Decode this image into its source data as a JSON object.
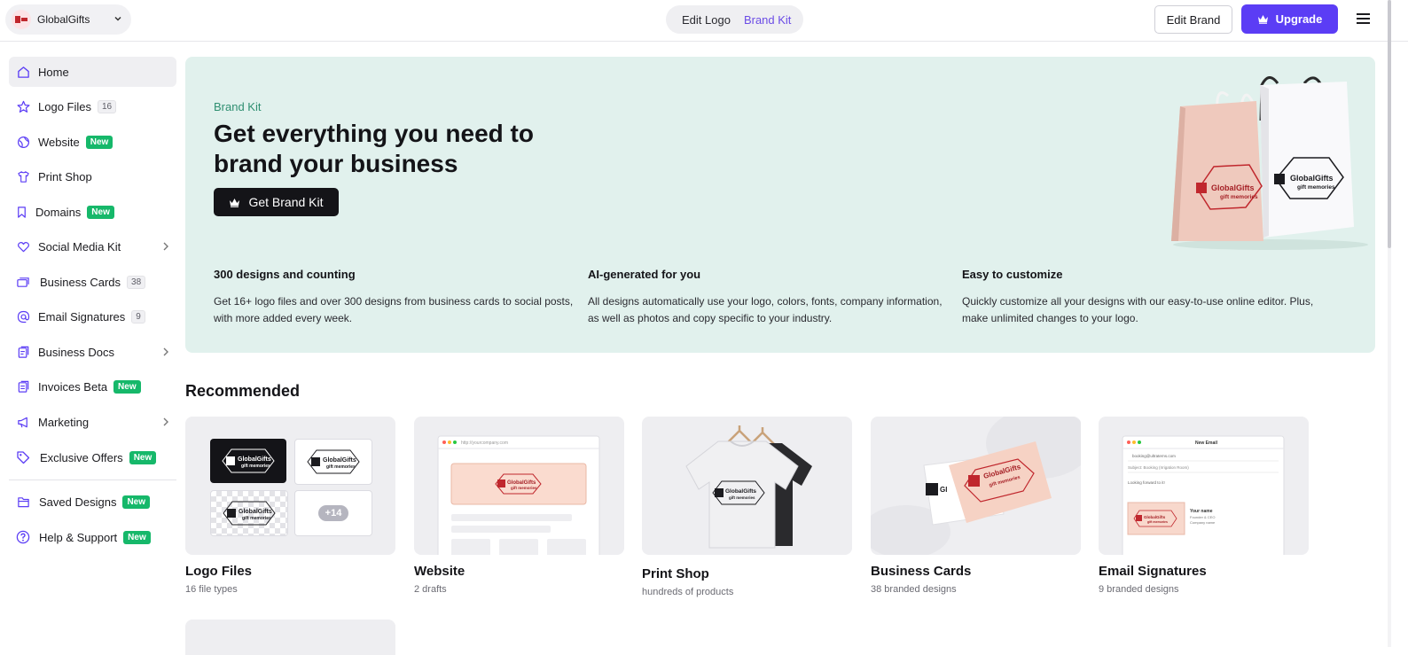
{
  "header": {
    "brand_name": "GlobalGifts",
    "mode_tabs": [
      {
        "label": "Edit Logo",
        "active": false
      },
      {
        "label": "Brand Kit",
        "active": true
      }
    ],
    "edit_brand_label": "Edit Brand",
    "upgrade_label": "Upgrade",
    "accent_color": "#5b3df5"
  },
  "sidebar": {
    "items": [
      {
        "label": "Home",
        "icon": "home-icon",
        "active": true
      },
      {
        "label": "Logo Files",
        "icon": "star-icon",
        "count": "16"
      },
      {
        "label": "Website",
        "icon": "globe-icon",
        "badge": "New"
      },
      {
        "label": "Print Shop",
        "icon": "shirt-icon"
      },
      {
        "label": "Domains",
        "icon": "bookmark-icon",
        "badge": "New"
      },
      {
        "label": "Social Media Kit",
        "icon": "heart-icon",
        "has_submenu": true
      },
      {
        "label": "Business Cards",
        "icon": "cards-icon",
        "count": "38"
      },
      {
        "label": "Email Signatures",
        "icon": "at-icon",
        "count": "9"
      },
      {
        "label": "Business Docs",
        "icon": "document-icon",
        "has_submenu": true
      },
      {
        "label": "Invoices Beta",
        "icon": "invoice-icon",
        "badge": "New"
      },
      {
        "label": "Marketing",
        "icon": "megaphone-icon",
        "has_submenu": true
      },
      {
        "label": "Exclusive Offers",
        "icon": "tag-icon",
        "badge": "New"
      },
      {
        "label": "Saved Designs",
        "icon": "folder-icon",
        "badge": "New"
      },
      {
        "label": "Help & Support",
        "icon": "help-icon",
        "badge": "New"
      }
    ]
  },
  "hero": {
    "eyebrow": "Brand Kit",
    "headline": "Get everything you need to brand your business",
    "cta_label": "Get Brand Kit",
    "background": "#e1f1ed",
    "features": [
      {
        "title": "300 designs and counting",
        "text": "Get 16+ logo files and over 300 designs from business cards to social posts, with more added every week."
      },
      {
        "title": "AI-generated for you",
        "text": "All designs automatically use your logo, colors, fonts, company information, as well as photos and copy specific to your industry."
      },
      {
        "title": "Easy to customize",
        "text": "Quickly customize all your designs with our easy-to-use online editor. Plus, make unlimited changes to your logo."
      }
    ]
  },
  "mockup": {
    "logo_name": "GlobalGifts",
    "logo_tagline": "gift memories",
    "more_files": "+14",
    "browser_url": "http://yourcompany.com",
    "email_window_title": "New Email",
    "email_from": "booking@ultraterns.com",
    "email_subject": "Subject: Booking (Irrigation Room)",
    "email_body": "Looking forward to it!",
    "signature_name": "Your name",
    "signature_role": "Founder & CEO",
    "signature_company": "Company name"
  },
  "recommended": {
    "title": "Recommended",
    "cards": [
      {
        "title": "Logo Files",
        "subtitle": "16 file types"
      },
      {
        "title": "Website",
        "subtitle": "2 drafts"
      },
      {
        "title": "Print Shop",
        "subtitle": "hundreds of products"
      },
      {
        "title": "Business Cards",
        "subtitle": "38 branded designs"
      },
      {
        "title": "Email Signatures",
        "subtitle": "9 branded designs"
      }
    ]
  }
}
